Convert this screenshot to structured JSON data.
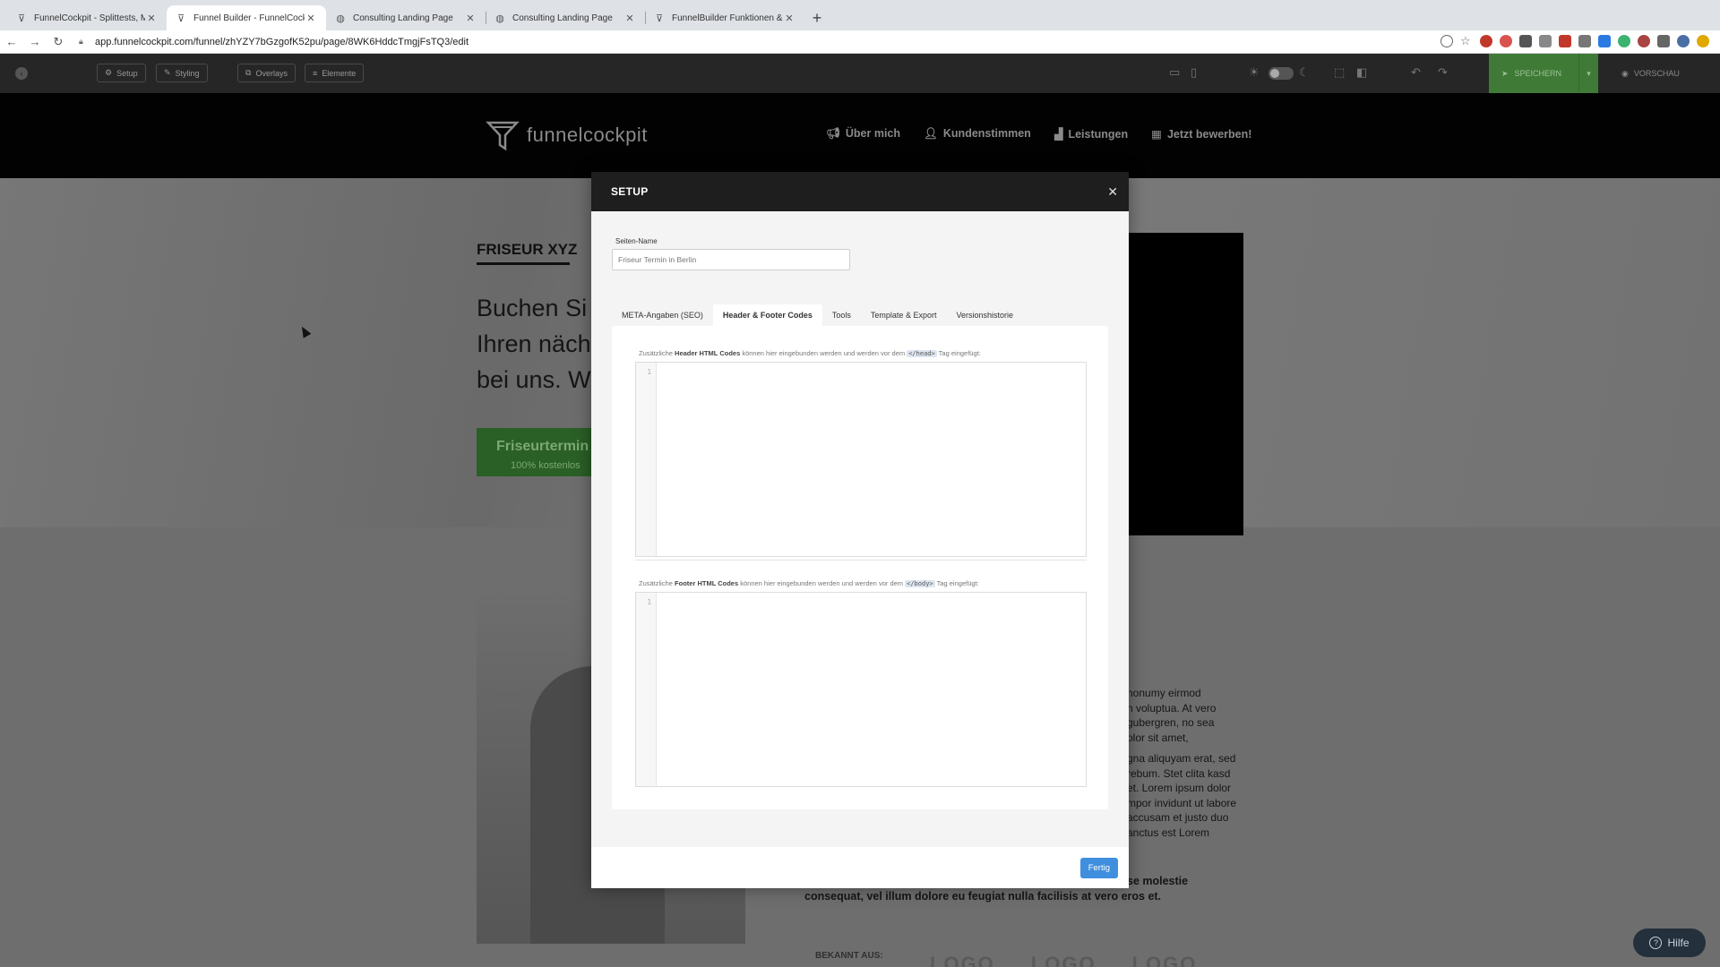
{
  "browser": {
    "tabs": [
      {
        "title": "FunnelCockpit - Splittests, Ma",
        "icon": "funnel-icon",
        "active": false
      },
      {
        "title": "Funnel Builder - FunnelCockpit",
        "icon": "funnel-icon",
        "active": true
      },
      {
        "title": "Consulting Landing Page",
        "icon": "globe-icon",
        "active": false
      },
      {
        "title": "Consulting Landing Page",
        "icon": "globe-icon",
        "active": false
      },
      {
        "title": "FunnelBuilder Funktionen & El",
        "icon": "funnel-icon",
        "active": false
      }
    ],
    "url": "app.funnelcockpit.com/funnel/zhYZY7bGzgofK52pu/page/8WK6HddcTmgjFsTQ3/edit"
  },
  "toolbar": {
    "setup": "Setup",
    "styling": "Styling",
    "overlays": "Overlays",
    "elements": "Elemente",
    "save": "SPEICHERN",
    "preview": "VORSCHAU"
  },
  "site": {
    "brand": "funnelcockpit",
    "nav": [
      {
        "label": "Über mich",
        "icon": "megaphone-icon"
      },
      {
        "label": "Kundenstimmen",
        "icon": "user-icon"
      },
      {
        "label": "Leistungen",
        "icon": "chart-icon"
      },
      {
        "label": "Jetzt bewerben!",
        "icon": "calendar-icon"
      }
    ],
    "hero_title": "FRISEUR XYZ",
    "hero_heading": "Buchen Si\nIhren näch\nbei uns. W",
    "cta_line1": "Friseurtermin",
    "cta_line2": "100% kostenlos",
    "body_paragraphs": [
      "nonumy eirmod\nn voluptua. At vero\ngubergren, no sea\nolor sit amet,",
      "gna aliquyam erat, sed\nrebum. Stet clita kasd\net. Lorem ipsum dolor\nmpor invidunt ut labore\n accusam et justo duo\nanctus est Lorem"
    ],
    "bold_line1": "se molestie",
    "bold_line2": "consequat, vel illum dolore eu feugiat nulla facilisis at vero eros et.",
    "known_label": "BEKANNT AUS:",
    "logo_placeholder": "LOGO"
  },
  "modal": {
    "title": "SETUP",
    "page_name_label": "Seiten-Name",
    "page_name_value": "Friseur Termin in Berlin",
    "tabs": [
      "META-Angaben (SEO)",
      "Header & Footer Codes",
      "Tools",
      "Template & Export",
      "Versionshistorie"
    ],
    "active_tab": "Header & Footer Codes",
    "header_hint_pre": "Zusätzliche ",
    "header_hint_bold": "Header HTML Codes",
    "header_hint_mid": " können hier eingebunden werden und werden vor dem ",
    "header_hint_code": "</head>",
    "header_hint_post": " Tag eingefügt:",
    "footer_hint_pre": "Zusätzliche ",
    "footer_hint_bold": "Footer HTML Codes",
    "footer_hint_mid": " können hier eingebunden werden und werden vor dem ",
    "footer_hint_code": "</body>",
    "footer_hint_post": " Tag eingefügt:",
    "line_number": "1",
    "done": "Fertig"
  },
  "help": "Hilfe",
  "colors": {
    "save_green": "#3f7a37",
    "done_blue": "#3f8fde",
    "modal_header": "#1e1e1e"
  }
}
